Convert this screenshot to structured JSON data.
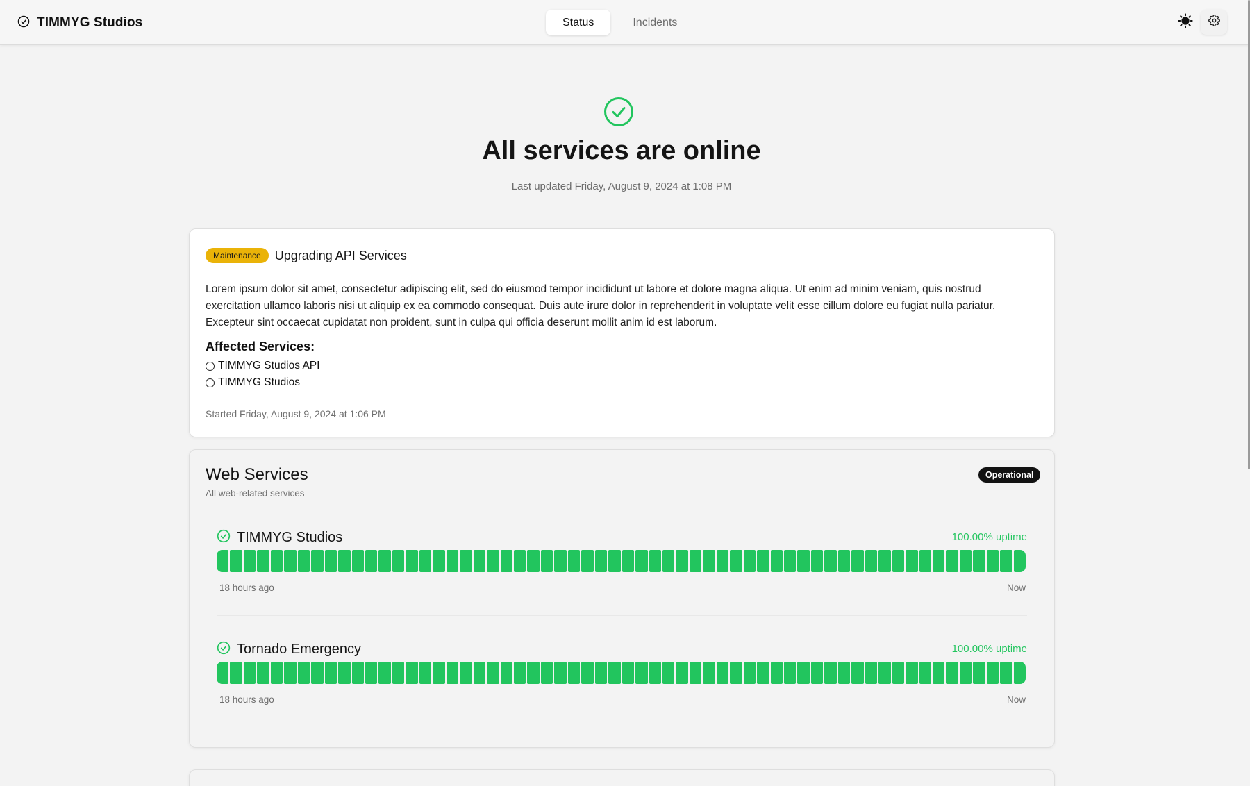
{
  "colors": {
    "accent_green": "#22c55e",
    "maintenance_badge": "#eab308",
    "operational_badge": "#121212"
  },
  "header": {
    "brand": "TIMMYG Studios",
    "brand_icon": "check-circle-icon",
    "tabs": [
      {
        "label": "Status",
        "active": true
      },
      {
        "label": "Incidents",
        "active": false
      }
    ],
    "theme_icon": "sun-icon",
    "settings_icon": "gear-icon"
  },
  "hero": {
    "icon": "check-circle-icon",
    "title": "All services are online",
    "subtitle": "Last updated Friday, August 9, 2024 at 1:08 PM"
  },
  "maintenance": {
    "badge": "Maintenance",
    "title": "Upgrading API Services",
    "description": "Lorem ipsum dolor sit amet, consectetur adipiscing elit, sed do eiusmod tempor incididunt ut labore et dolore magna aliqua. Ut enim ad minim veniam, quis nostrud exercitation ullamco laboris nisi ut aliquip ex ea commodo consequat. Duis aute irure dolor in reprehenderit in voluptate velit esse cillum dolore eu fugiat nulla pariatur. Excepteur sint occaecat cupidatat non proident, sunt in culpa qui officia deserunt mollit anim id est laborum.",
    "affected_title": "Affected Services:",
    "affected": [
      "TIMMYG Studios API",
      "TIMMYG Studios"
    ],
    "started": "Started Friday, August 9, 2024 at 1:06 PM"
  },
  "web_services": {
    "title": "Web Services",
    "subtitle": "All web-related services",
    "status_badge": "Operational",
    "services": [
      {
        "name": "TIMMYG Studios",
        "icon": "check-circle-icon",
        "uptime": "100.00% uptime",
        "from_label": "18 hours ago",
        "to_label": "Now",
        "bar_count": 60,
        "bar_states": "all-up"
      },
      {
        "name": "Tornado Emergency",
        "icon": "check-circle-icon",
        "uptime": "100.00% uptime",
        "from_label": "18 hours ago",
        "to_label": "Now",
        "bar_count": 60,
        "bar_states": "all-up"
      }
    ]
  }
}
